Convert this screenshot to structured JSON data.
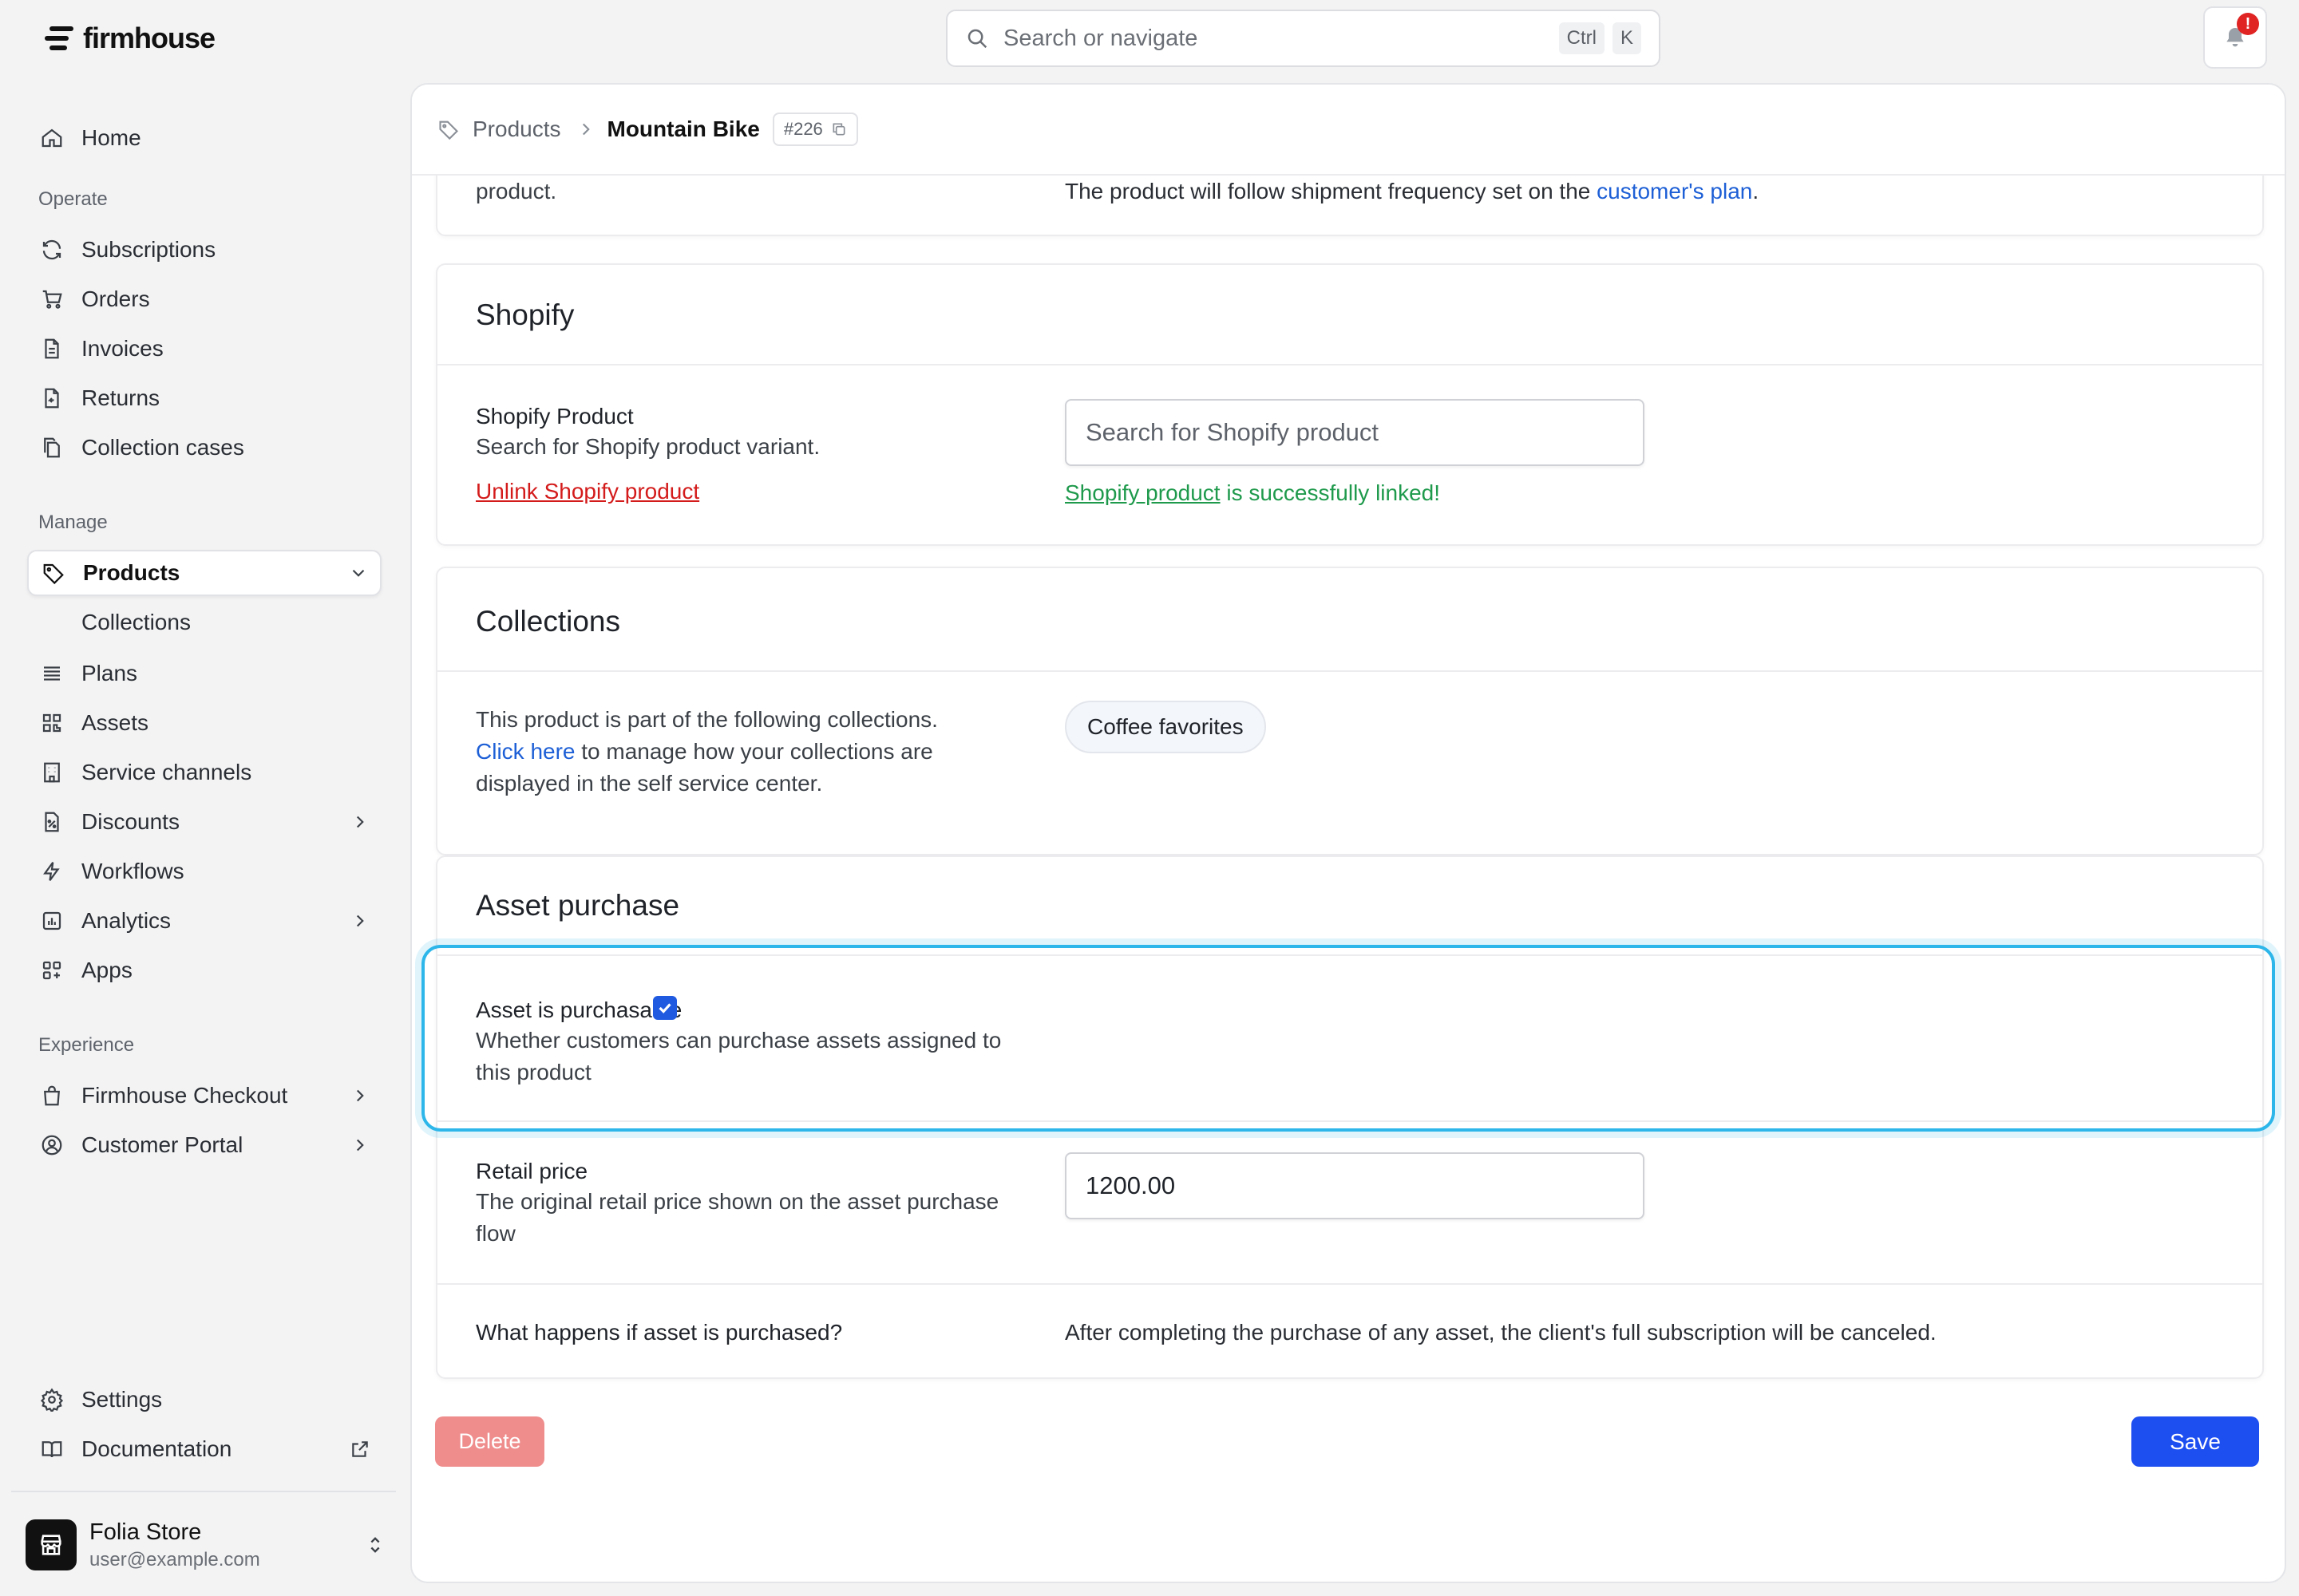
{
  "app": {
    "brand": "firmhouse"
  },
  "search": {
    "placeholder": "Search or navigate",
    "shortcut_ctrl": "Ctrl",
    "shortcut_key": "K"
  },
  "notifications": {
    "badge": "!"
  },
  "sidebar": {
    "home": "Home",
    "sections": {
      "operate": "Operate",
      "manage": "Manage",
      "experience": "Experience"
    },
    "operate": [
      "Subscriptions",
      "Orders",
      "Invoices",
      "Returns",
      "Collection cases"
    ],
    "manage": {
      "products": "Products",
      "collections": "Collections",
      "plans": "Plans",
      "assets": "Assets",
      "service_channels": "Service channels",
      "discounts": "Discounts",
      "workflows": "Workflows",
      "analytics": "Analytics",
      "apps": "Apps"
    },
    "experience": {
      "checkout": "Firmhouse Checkout",
      "portal": "Customer Portal"
    },
    "settings": "Settings",
    "documentation": "Documentation",
    "store": {
      "name": "Folia Store",
      "email": "user@example.com"
    }
  },
  "breadcrumb": {
    "parent": "Products",
    "current": "Mountain Bike",
    "id": "#226"
  },
  "top_card": {
    "left_text": "product.",
    "right_prefix": "The product will follow shipment frequency set on the ",
    "right_link": "customer's plan",
    "right_suffix": "."
  },
  "shopify": {
    "title": "Shopify",
    "label": "Shopify Product",
    "desc": "Search for Shopify product variant.",
    "unlink": "Unlink Shopify product",
    "input_placeholder": "Search for Shopify product",
    "status_link": "Shopify product",
    "status_suffix": " is successfully linked!"
  },
  "collections": {
    "title": "Collections",
    "desc_line1": "This product is part of the following collections.",
    "desc_link": "Click here",
    "desc_line2": " to manage how your collections are",
    "desc_line3": "displayed in the self service center.",
    "chip": "Coffee favorites"
  },
  "asset_purchase": {
    "title": "Asset purchase",
    "purchasable_label": "Asset is purchasable",
    "purchasable_desc_1": "Whether customers can purchase assets assigned to",
    "purchasable_desc_2": "this product",
    "purchasable_checked": true,
    "retail_label": "Retail price",
    "retail_desc_1": "The original retail price shown on the asset purchase",
    "retail_desc_2": "flow",
    "retail_value": "1200.00",
    "what_happens_label": "What happens if asset is purchased?",
    "what_happens_text": "After completing the purchase of any asset, the client's full subscription will be canceled."
  },
  "actions": {
    "delete": "Delete",
    "save": "Save"
  },
  "colors": {
    "accent": "#1d4ef0",
    "highlight": "#2cb6e9",
    "danger": "#ef8d8d",
    "success": "#1f9a4c"
  }
}
